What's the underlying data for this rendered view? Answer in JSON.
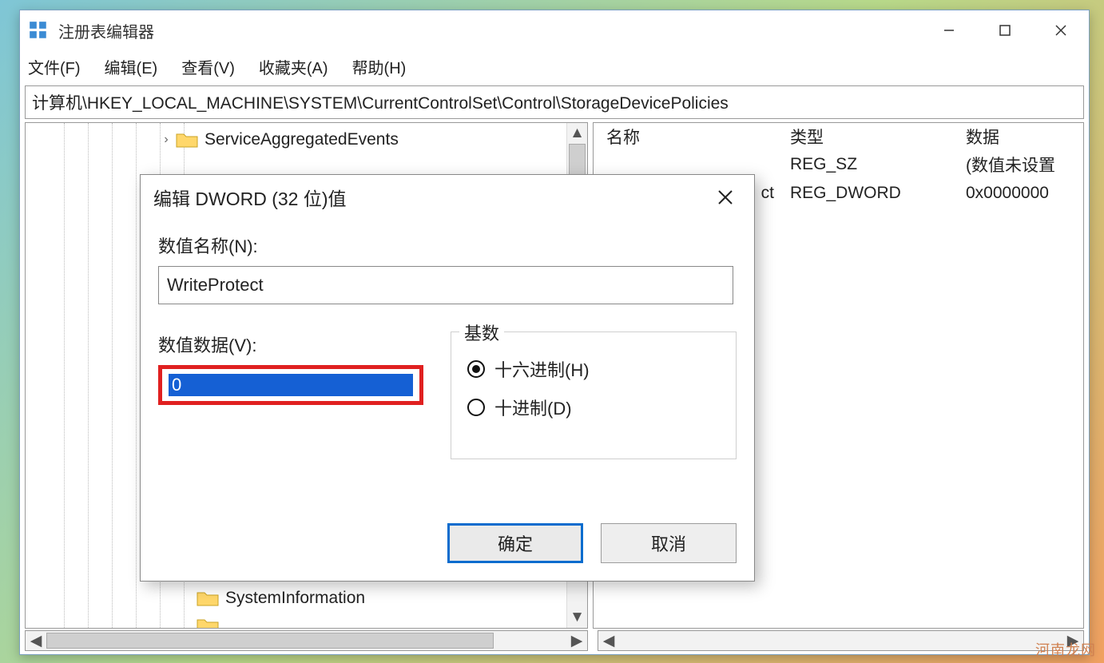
{
  "app": {
    "title": "注册表编辑器"
  },
  "menu": {
    "file": "文件(F)",
    "edit": "编辑(E)",
    "view": "查看(V)",
    "favorites": "收藏夹(A)",
    "help": "帮助(H)"
  },
  "address": "计算机\\HKEY_LOCAL_MACHINE\\SYSTEM\\CurrentControlSet\\Control\\StorageDevicePolicies",
  "tree": {
    "item_service_aggregated": "ServiceAggregatedEvents",
    "item_system_information": "SystemInformation"
  },
  "list": {
    "headers": {
      "name": "名称",
      "type": "类型",
      "data": "数据"
    },
    "rows": [
      {
        "name": "",
        "type": "REG_SZ",
        "data": "(数值未设置"
      },
      {
        "name": "ct",
        "type": "REG_DWORD",
        "data": "0x0000000"
      }
    ]
  },
  "dialog": {
    "title": "编辑 DWORD (32 位)值",
    "name_label": "数值名称(N):",
    "name_value": "WriteProtect",
    "value_label": "数值数据(V):",
    "value_value": "0",
    "base_legend": "基数",
    "radio_hex": "十六进制(H)",
    "radio_dec": "十进制(D)",
    "ok": "确定",
    "cancel": "取消"
  },
  "watermark": "河南龙网"
}
